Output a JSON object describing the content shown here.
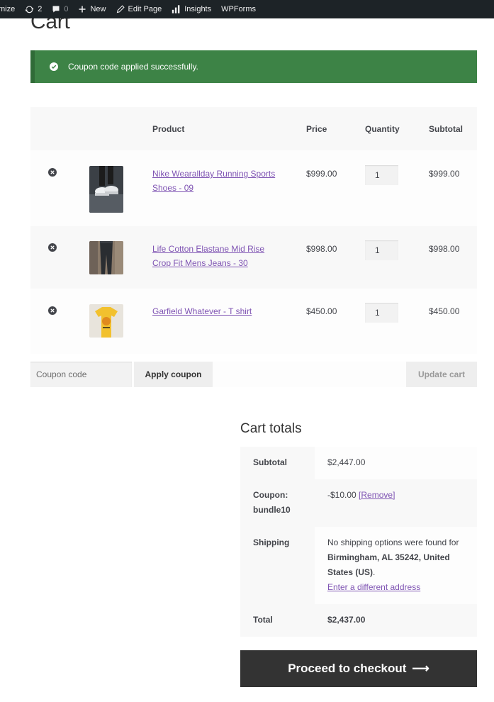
{
  "admin_bar": {
    "customize": "mize",
    "updates_count": "2",
    "comments_count": "0",
    "new_label": "New",
    "edit_label": "Edit Page",
    "insights_label": "Insights",
    "wpforms_label": "WPForms"
  },
  "page": {
    "title": "Cart"
  },
  "notice": {
    "message": "Coupon code applied successfully."
  },
  "cart": {
    "headers": {
      "product": "Product",
      "price": "Price",
      "quantity": "Quantity",
      "subtotal": "Subtotal"
    },
    "items": [
      {
        "name": "Nike Wearallday Running Sports Shoes - 09",
        "price": "$999.00",
        "quantity": "1",
        "subtotal": "$999.00"
      },
      {
        "name": "Life Cotton Elastane Mid Rise Crop Fit Mens Jeans - 30",
        "price": "$998.00",
        "quantity": "1",
        "subtotal": "$998.00"
      },
      {
        "name": "Garfield Whatever - T shirt",
        "price": "$450.00",
        "quantity": "1",
        "subtotal": "$450.00"
      }
    ],
    "coupon_placeholder": "Coupon code",
    "apply_label": "Apply coupon",
    "update_label": "Update cart"
  },
  "totals": {
    "title": "Cart totals",
    "subtotal_label": "Subtotal",
    "subtotal_value": "$2,447.00",
    "coupon_label_1": "Coupon:",
    "coupon_label_2": "bundle10",
    "coupon_value": "-$10.00",
    "coupon_remove": "[Remove]",
    "shipping_label": "Shipping",
    "shipping_text": "No shipping options were found for",
    "shipping_address": "Birmingham, AL 35242, United States (US)",
    "shipping_period": ".",
    "shipping_link": "Enter a different address",
    "total_label": "Total",
    "total_value": "$2,437.00"
  },
  "checkout": {
    "label": "Proceed to checkout",
    "arrow": "⟶"
  },
  "colors": {
    "notice_green": "#3d8346",
    "link_purple": "#7f54b3",
    "button_dark": "#333333"
  }
}
